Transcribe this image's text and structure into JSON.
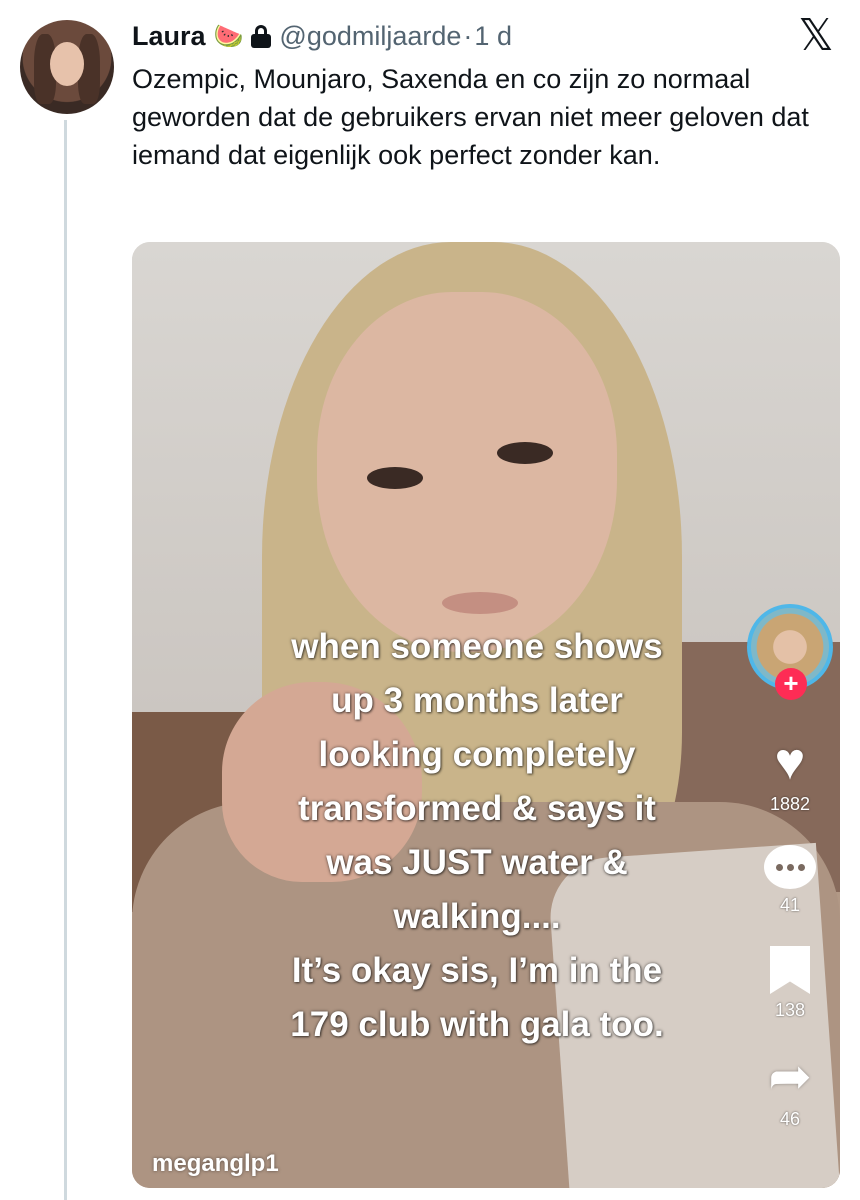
{
  "tweet": {
    "author_name": "Laura",
    "author_emoji": "🍉",
    "handle": "@godmiljaarde",
    "separator": "·",
    "time": "1 d",
    "text": "Ozempic, Mounjaro, Saxenda en co zijn zo normaal geworden dat de gebruikers ervan niet meer geloven dat iemand dat eigenlijk ook perfect zonder kan."
  },
  "platform_logo": "𝕏",
  "video": {
    "caption": "when someone shows\nup 3 months later\nlooking completely\ntransformed & says it\nwas JUST water &\nwalking....\nIt’s okay sis, I’m in the\n179 club with gala too.",
    "username": "meganglp1",
    "follow_symbol": "+",
    "likes": "1882",
    "comments": "41",
    "saves": "138",
    "shares": "46",
    "icons": {
      "like": "heart-icon",
      "comment": "comment-icon",
      "save": "bookmark-icon",
      "share": "share-arrow-icon"
    },
    "colors": {
      "follow_badge": "#fe2c55",
      "avatar_ring": "#4fb7e8"
    }
  }
}
